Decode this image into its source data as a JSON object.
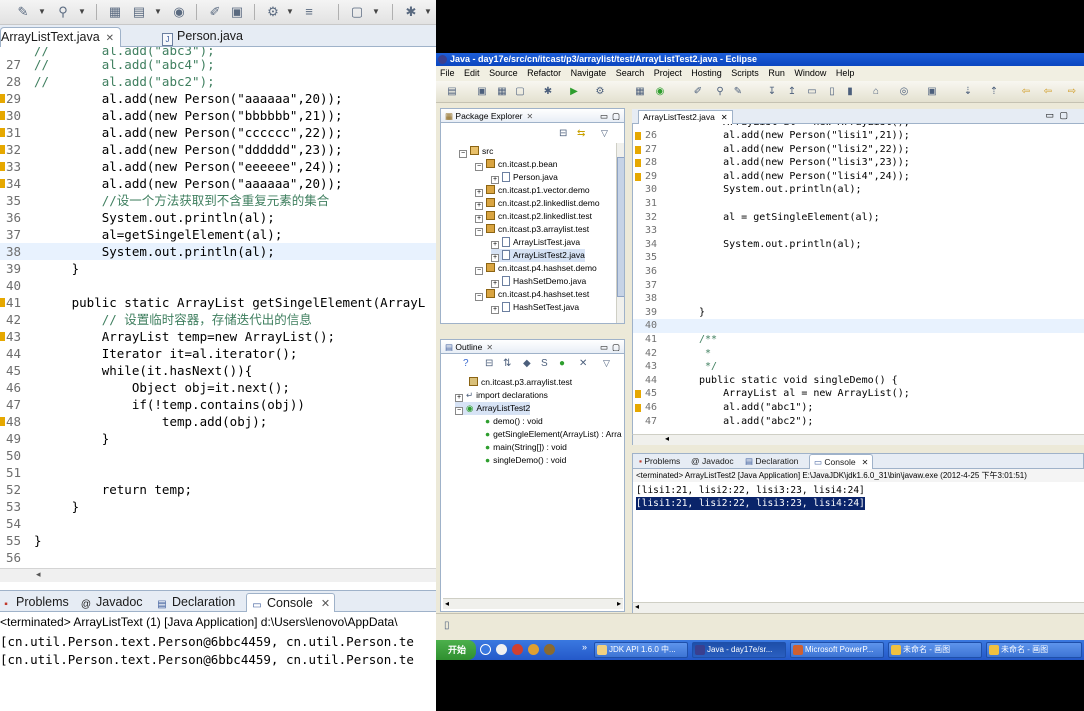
{
  "left_window": {
    "tabs": [
      {
        "label": "ArrayListText.java",
        "active": true
      },
      {
        "label": "Person.java",
        "active": false
      }
    ],
    "code_lines": [
      {
        "n": "27",
        "t": "//       al.add(\"abc4\");"
      },
      {
        "n": "28",
        "t": "//       al.add(\"abc2\");"
      },
      {
        "n": "29",
        "t": "         al.add(new Person(\"aaaaaa\",20));"
      },
      {
        "n": "30",
        "t": "         al.add(new Person(\"bbbbbb\",21));"
      },
      {
        "n": "31",
        "t": "         al.add(new Person(\"cccccc\",22));"
      },
      {
        "n": "32",
        "t": "         al.add(new Person(\"dddddd\",23));"
      },
      {
        "n": "33",
        "t": "         al.add(new Person(\"eeeeee\",24));"
      },
      {
        "n": "34",
        "t": "         al.add(new Person(\"aaaaaa\",20));"
      },
      {
        "n": "35",
        "t": "         //设一个方法获取到不含重复元素的集合"
      },
      {
        "n": "36",
        "t": "         System.out.println(al);"
      },
      {
        "n": "37",
        "t": "         al=getSingelElement(al);"
      },
      {
        "n": "38",
        "t": "         System.out.println(al);"
      },
      {
        "n": "39",
        "t": "     }"
      },
      {
        "n": "40",
        "t": ""
      },
      {
        "n": "41",
        "t": "     public static ArrayList getSingelElement(ArrayL"
      },
      {
        "n": "42",
        "t": "         // 设置临时容器，存储迭代出的信息"
      },
      {
        "n": "43",
        "t": "         ArrayList temp=new ArrayList();"
      },
      {
        "n": "44",
        "t": "         Iterator it=al.iterator();"
      },
      {
        "n": "45",
        "t": "         while(it.hasNext()){"
      },
      {
        "n": "46",
        "t": "             Object obj=it.next();"
      },
      {
        "n": "47",
        "t": "             if(!temp.contains(obj))"
      },
      {
        "n": "48",
        "t": "                 temp.add(obj);"
      },
      {
        "n": "49",
        "t": "         }"
      },
      {
        "n": "50",
        "t": ""
      },
      {
        "n": "51",
        "t": ""
      },
      {
        "n": "52",
        "t": "         return temp;"
      },
      {
        "n": "53",
        "t": "     }"
      },
      {
        "n": "54",
        "t": ""
      },
      {
        "n": "55",
        "t": "}"
      },
      {
        "n": "56",
        "t": ""
      }
    ],
    "bottom_tabs": {
      "problems": "Problems",
      "javadoc": "Javadoc",
      "declaration": "Declaration",
      "console": "Console"
    },
    "console_status": "<terminated> ArrayListText (1) [Java Application] d:\\Users\\lenovo\\AppData\\",
    "console_lines": [
      "[cn.util.Person.text.Person@6bbc4459, cn.util.Person.te",
      "[cn.util.Person.text.Person@6bbc4459, cn.util.Person.te"
    ]
  },
  "right_window": {
    "title": "Java - day17e/src/cn/itcast/p3/arraylist/test/ArrayListTest2.java - Eclipse",
    "menu": [
      "File",
      "Edit",
      "Source",
      "Refactor",
      "Navigate",
      "Search",
      "Project",
      "Hosting",
      "Scripts",
      "Run",
      "Window",
      "Help"
    ],
    "package_explorer": {
      "title": "Package Explorer",
      "items": [
        {
          "label": "src",
          "kind": "folder"
        },
        {
          "label": "cn.itcast.p.bean",
          "kind": "pkg"
        },
        {
          "label": "Person.java",
          "kind": "file"
        },
        {
          "label": "cn.itcast.p1.vector.demo",
          "kind": "pkg"
        },
        {
          "label": "cn.itcast.p2.linkedlist.demo",
          "kind": "pkg"
        },
        {
          "label": "cn.itcast.p2.linkedlist.test",
          "kind": "pkg"
        },
        {
          "label": "cn.itcast.p3.arraylist.test",
          "kind": "pkg"
        },
        {
          "label": "ArrayListTest.java",
          "kind": "file"
        },
        {
          "label": "ArrayListTest2.java",
          "kind": "file"
        },
        {
          "label": "cn.itcast.p4.hashset.demo",
          "kind": "pkg"
        },
        {
          "label": "HashSetDemo.java",
          "kind": "file"
        },
        {
          "label": "cn.itcast.p4.hashset.test",
          "kind": "pkg"
        },
        {
          "label": "HashSetTest.java",
          "kind": "file"
        }
      ]
    },
    "outline": {
      "title": "Outline",
      "items": [
        {
          "label": "cn.itcast.p3.arraylist.test"
        },
        {
          "label": "import declarations"
        },
        {
          "label": "ArrayListTest2"
        },
        {
          "label": "demo() : void"
        },
        {
          "label": "getSingleElement(ArrayList) : Arra"
        },
        {
          "label": "main(String[]) : void"
        },
        {
          "label": "singleDemo() : void"
        }
      ]
    },
    "editor_tab": "ArrayListTest2.java",
    "editor_lines": [
      {
        "n": "26",
        "t": "     al.add(new Person(\"lisi1\",21));"
      },
      {
        "n": "27",
        "t": "     al.add(new Person(\"lisi2\",22));"
      },
      {
        "n": "28",
        "t": "     al.add(new Person(\"lisi3\",23));"
      },
      {
        "n": "29",
        "t": "     al.add(new Person(\"lisi4\",24));"
      },
      {
        "n": "30",
        "t": "     System.out.println(al);"
      },
      {
        "n": "31",
        "t": ""
      },
      {
        "n": "32",
        "t": "     al = getSingleElement(al);"
      },
      {
        "n": "33",
        "t": ""
      },
      {
        "n": "34",
        "t": "     System.out.println(al);"
      },
      {
        "n": "35",
        "t": ""
      },
      {
        "n": "36",
        "t": ""
      },
      {
        "n": "37",
        "t": ""
      },
      {
        "n": "38",
        "t": ""
      },
      {
        "n": "39",
        "t": " }"
      },
      {
        "n": "40",
        "t": ""
      },
      {
        "n": "41",
        "t": " /**"
      },
      {
        "n": "42",
        "t": "  *"
      },
      {
        "n": "43",
        "t": "  */"
      },
      {
        "n": "44",
        "t": " public static void singleDemo() {"
      },
      {
        "n": "45",
        "t": "     ArrayList al = new ArrayList();"
      },
      {
        "n": "46",
        "t": "     al.add(\"abc1\");"
      },
      {
        "n": "47",
        "t": "     al.add(\"abc2\");"
      }
    ],
    "bottom_tabs": {
      "problems": "Problems",
      "javadoc": "Javadoc",
      "declaration": "Declaration",
      "console": "Console"
    },
    "console_status": "<terminated> ArrayListTest2 [Java Application] E:\\JavaJDK\\jdk1.6.0_31\\bin\\javaw.exe (2012-4-25 下午3:01:51)",
    "console_lines": [
      "[lisi1:21, lisi2:22, lisi3:23, lisi4:24]",
      "[lisi1:21, lisi2:22, lisi3:23, lisi4:24]"
    ]
  },
  "taskbar": {
    "start": "开始",
    "buttons": [
      "JDK API 1.6.0 中...",
      "Java - day17e/sr...",
      "Microsoft PowerP...",
      "未命名 - 画图",
      "未命名 - 画图"
    ]
  }
}
